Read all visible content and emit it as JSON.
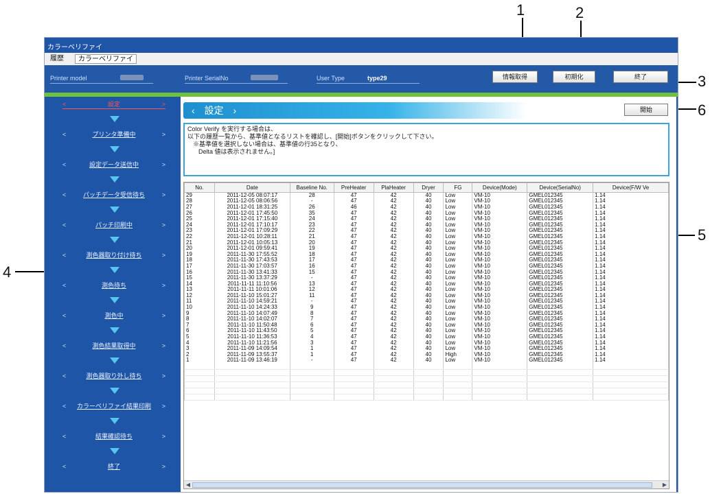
{
  "window": {
    "title": "カラーベリファイ"
  },
  "menu": {
    "item1": "履歴",
    "item2": "カラーベリファイ"
  },
  "info": {
    "printer_model_label": "Printer model",
    "printer_serial_label": "Printer SerialNo",
    "user_type_label": "User Type",
    "user_type_value": "type29"
  },
  "header_buttons": {
    "info_get": "情報取得",
    "initialize": "初期化",
    "exit": "終了"
  },
  "panel": {
    "title": "設定",
    "start_button": "開始"
  },
  "message": {
    "line1": "Color Verify を実行する場合は、",
    "line2": "以下の履歴一覧から、基準値となるリストを確認し、[開始]ボタンをクリックして下さい。",
    "line3": "※基準値を選択しない場合は、基準値の行35となり、",
    "line4": "Delta 値は表示されません。]"
  },
  "steps": [
    "設定",
    "プリンタ準備中",
    "設定データ送信中",
    "パッチデータ受信待ち",
    "パッチ印刷中",
    "測色器取り付け待ち",
    "測色待ち",
    "測色中",
    "測色結果取得中",
    "測色器取り外し待ち",
    "カラーベリファイ結果印刷",
    "結果確認待ち",
    "終了"
  ],
  "callouts": [
    "1",
    "2",
    "3",
    "4",
    "5",
    "6"
  ],
  "table": {
    "headers": [
      "No.",
      "Date",
      "Baseline No.",
      "PreHeater",
      "PlaHeater",
      "Dryer",
      "FG",
      "Device(Mode)",
      "Device(SerialNo)",
      "Device(F/W Ve"
    ],
    "rows": [
      [
        "29",
        "2011-12-05 08:07:17",
        "28",
        "47",
        "42",
        "40",
        "Low",
        "VM-10",
        "GMEL012345",
        "1.14"
      ],
      [
        "28",
        "2011-12-05 08:06:56",
        "-",
        "47",
        "42",
        "40",
        "Low",
        "VM-10",
        "GMEL012345",
        "1.14"
      ],
      [
        "27",
        "2011-12-01 18:31:25",
        "26",
        "46",
        "42",
        "40",
        "Low",
        "VM-10",
        "GMEL012345",
        "1.14"
      ],
      [
        "26",
        "2011-12-01 17:45:50",
        "35",
        "47",
        "42",
        "40",
        "Low",
        "VM-10",
        "GMEL012345",
        "1.14"
      ],
      [
        "25",
        "2011-12-01 17:15:40",
        "24",
        "47",
        "42",
        "40",
        "Low",
        "VM-10",
        "GMEL012345",
        "1.14"
      ],
      [
        "24",
        "2011-12-01 17:10:17",
        "23",
        "47",
        "42",
        "40",
        "Low",
        "VM-10",
        "GMEL012345",
        "1.14"
      ],
      [
        "23",
        "2011-12-01 17:09:29",
        "22",
        "47",
        "42",
        "40",
        "Low",
        "VM-10",
        "GMEL012345",
        "1.14"
      ],
      [
        "22",
        "2011-12-01 10:28:11",
        "21",
        "47",
        "42",
        "40",
        "Low",
        "VM-10",
        "GMEL012345",
        "1.14"
      ],
      [
        "21",
        "2011-12-01 10:05:13",
        "20",
        "47",
        "42",
        "40",
        "Low",
        "VM-10",
        "GMEL012345",
        "1.14"
      ],
      [
        "20",
        "2011-12-01 09:59:41",
        "19",
        "47",
        "42",
        "40",
        "Low",
        "VM-10",
        "GMEL012345",
        "1.14"
      ],
      [
        "19",
        "2011-11-30 17:55:52",
        "18",
        "47",
        "42",
        "40",
        "Low",
        "VM-10",
        "GMEL012345",
        "1.14"
      ],
      [
        "18",
        "2011-11-30 17:43:53",
        "17",
        "47",
        "42",
        "40",
        "Low",
        "VM-10",
        "GMEL012345",
        "1.14"
      ],
      [
        "17",
        "2011-11-30 17:03:57",
        "16",
        "47",
        "42",
        "40",
        "Low",
        "VM-10",
        "GMEL012345",
        "1.14"
      ],
      [
        "16",
        "2011-11-30 13:41:33",
        "15",
        "47",
        "42",
        "40",
        "Low",
        "VM-10",
        "GMEL012345",
        "1.14"
      ],
      [
        "15",
        "2011-11-30 13:37:29",
        "-",
        "47",
        "42",
        "40",
        "Low",
        "VM-10",
        "GMEL012345",
        "1.14"
      ],
      [
        "14",
        "2011-11-11 11:10:56",
        "13",
        "47",
        "42",
        "40",
        "Low",
        "VM-10",
        "GMEL012345",
        "1.14"
      ],
      [
        "13",
        "2011-11-11 10:01:06",
        "12",
        "47",
        "42",
        "40",
        "Low",
        "VM-10",
        "GMEL012345",
        "1.14"
      ],
      [
        "12",
        "2011-11-10 15:01:27",
        "11",
        "47",
        "42",
        "40",
        "Low",
        "VM-10",
        "GMEL012345",
        "1.14"
      ],
      [
        "11",
        "2011-11-10 14:59:21",
        "-",
        "47",
        "42",
        "40",
        "Low",
        "VM-10",
        "GMEL012345",
        "1.14"
      ],
      [
        "10",
        "2011-11-10 14:24:33",
        "9",
        "47",
        "42",
        "40",
        "Low",
        "VM-10",
        "GMEL012345",
        "1.14"
      ],
      [
        "9",
        "2011-11-10 14:07:49",
        "8",
        "47",
        "42",
        "40",
        "Low",
        "VM-10",
        "GMEL012345",
        "1.14"
      ],
      [
        "8",
        "2011-11-10 14:02:07",
        "7",
        "47",
        "42",
        "40",
        "Low",
        "VM-10",
        "GMEL012345",
        "1.14"
      ],
      [
        "7",
        "2011-11-10 11:50:48",
        "6",
        "47",
        "42",
        "40",
        "Low",
        "VM-10",
        "GMEL012345",
        "1.14"
      ],
      [
        "6",
        "2011-11-10 11:43:50",
        "5",
        "47",
        "42",
        "40",
        "Low",
        "VM-10",
        "GMEL012345",
        "1.14"
      ],
      [
        "5",
        "2011-11-10 11:36:53",
        "4",
        "47",
        "42",
        "40",
        "Low",
        "VM-10",
        "GMEL012345",
        "1.14"
      ],
      [
        "4",
        "2011-11-10 11:21:56",
        "3",
        "47",
        "42",
        "40",
        "Low",
        "VM-10",
        "GMEL012345",
        "1.14"
      ],
      [
        "3",
        "2011-11-09 14:09:54",
        "1",
        "47",
        "42",
        "40",
        "Low",
        "VM-10",
        "GMEL012345",
        "1.14"
      ],
      [
        "2",
        "2011-11-09 13:55:37",
        "1",
        "47",
        "42",
        "40",
        "High",
        "VM-10",
        "GMEL012345",
        "1.14"
      ],
      [
        "1",
        "2011-11-09 13:46:19",
        "-",
        "47",
        "42",
        "40",
        "Low",
        "VM-10",
        "GMEL012345",
        "1.14"
      ]
    ]
  }
}
